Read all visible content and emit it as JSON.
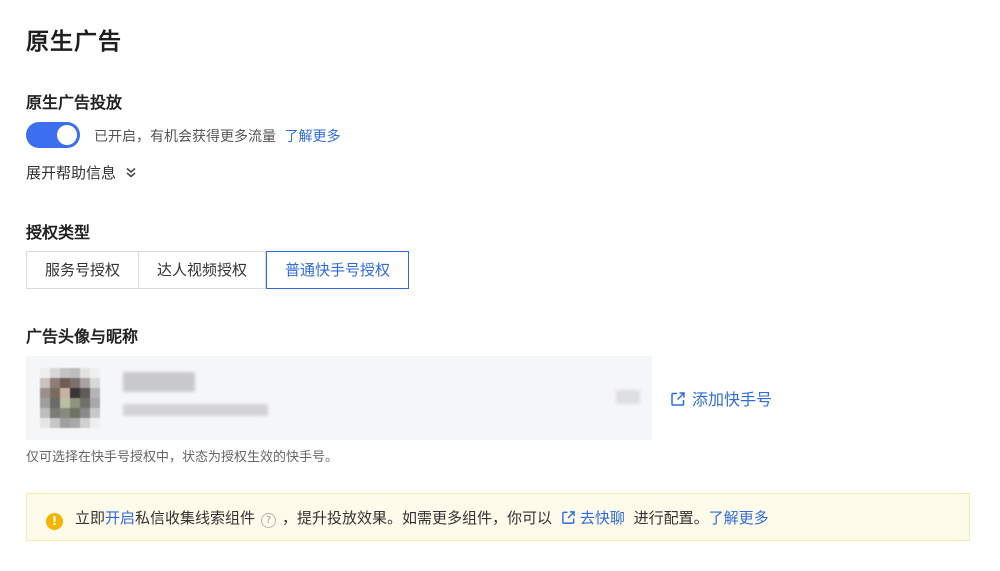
{
  "page": {
    "title": "原生广告"
  },
  "native_delivery": {
    "label": "原生广告投放",
    "toggle_on": true,
    "status_text": "已开启，有机会获得更多流量",
    "learn_more": "了解更多",
    "expand_help": "展开帮助信息"
  },
  "auth_type": {
    "label": "授权类型",
    "options": [
      "服务号授权",
      "达人视频授权",
      "普通快手号授权"
    ],
    "selected": "普通快手号授权"
  },
  "avatar_nickname": {
    "label": "广告头像与昵称",
    "add_account": "添加快手号",
    "hint": "仅可选择在快手号授权中，状态为授权生效的快手号。"
  },
  "notice": {
    "text_1": "立即",
    "link_open": "开启",
    "text_2": "私信收集线索组件",
    "text_3": "，提升投放效果。如需更多组件，你可以",
    "link_go": "去快聊",
    "text_4": "进行配置。",
    "link_learn": "了解更多"
  },
  "icons": {
    "notice": "warning-circle-icon",
    "help": "question-circle-icon",
    "external": "external-link-icon",
    "expand": "double-chevron-down-icon"
  },
  "colors": {
    "accent": "#2f6bdf",
    "toggle": "#3b6ff0",
    "warning": "#f4b400",
    "notice_bg": "#fefbea"
  }
}
